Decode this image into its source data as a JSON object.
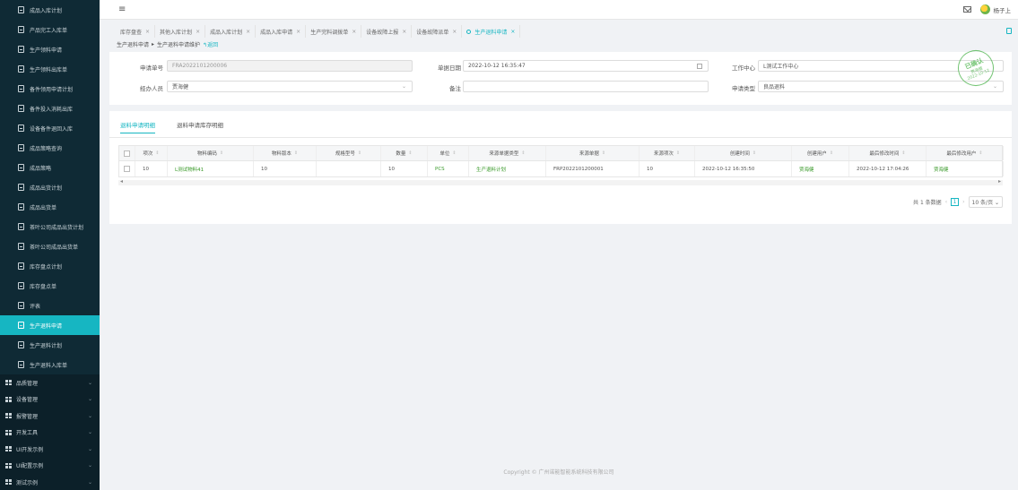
{
  "sidebar": {
    "items": [
      {
        "label": "成品入库计划"
      },
      {
        "label": "产品完工入库单"
      },
      {
        "label": "生产领料申请"
      },
      {
        "label": "生产领料出库单"
      },
      {
        "label": "备件领用申请计划"
      },
      {
        "label": "备件投入消耗出库"
      },
      {
        "label": "设备备件退回入库"
      },
      {
        "label": "成品策略查询"
      },
      {
        "label": "成品策略"
      },
      {
        "label": "成品出货计划"
      },
      {
        "label": "成品出货单"
      },
      {
        "label": "茶叶公司成品出货计划"
      },
      {
        "label": "茶叶公司成品出货单"
      },
      {
        "label": "库存盘点计划"
      },
      {
        "label": "库存盘点单"
      },
      {
        "label": "评表"
      },
      {
        "label": "生产退料申请"
      },
      {
        "label": "生产退料计划"
      },
      {
        "label": "生产退料入库单"
      }
    ],
    "active_index": 16,
    "groups": [
      {
        "label": "品质管理"
      },
      {
        "label": "设备管理"
      },
      {
        "label": "报警管理"
      },
      {
        "label": "开发工具"
      },
      {
        "label": "UI开发示例"
      },
      {
        "label": "UI配置示例"
      },
      {
        "label": "测试示例"
      }
    ]
  },
  "header": {
    "menu_icon": "≡",
    "username": "杨子上"
  },
  "tabs": [
    {
      "label": "库存盘查"
    },
    {
      "label": "其他入库计划"
    },
    {
      "label": "成品入库计划"
    },
    {
      "label": "成品入库申请"
    },
    {
      "label": "生产完料调拨单"
    },
    {
      "label": "设备故障上报"
    },
    {
      "label": "设备故障派单"
    },
    {
      "label": "生产退料申请",
      "active": true
    }
  ],
  "breadcrumb": {
    "first": "生产退料申请",
    "sep": "▸",
    "second": "生产退料申请维护",
    "back": "↰返回"
  },
  "form": {
    "apply_no_label": "申请单号",
    "apply_no_value": "FRA2022101200006",
    "date_label": "单据日期",
    "date_value": "2022-10-12 16:35:47",
    "work_center_label": "工作中心",
    "work_center_value": "L测试工作中心",
    "handler_label": "经办人员",
    "handler_value": "贾海健",
    "remark_label": "备注",
    "remark_value": "",
    "type_label": "申请类型",
    "type_value": "良品退料"
  },
  "stamp": {
    "line1": "已确认",
    "line2": "贾海健",
    "line3": "2022-10-12"
  },
  "detail": {
    "tabs": [
      "退料申请明细",
      "退料申请库存明细"
    ],
    "active_tab": 0,
    "columns": [
      "项次",
      "物料编码",
      "物料版本",
      "规格型号",
      "数量",
      "单位",
      "来源单据类型",
      "来源单据",
      "来源项次",
      "创建时间",
      "创建用户",
      "最后修改时间",
      "最后修改用户"
    ],
    "rows": [
      {
        "seq": "10",
        "code": "L测试物料41",
        "version": "10",
        "spec": "",
        "qty": "10",
        "unit": "PCS",
        "src_type": "生产退料计划",
        "src_no": "FRP2022101200001",
        "src_seq": "10",
        "created": "2022-10-12 16:35:50",
        "creator": "贾海健",
        "modified": "2022-10-12 17:04:26",
        "modifier": "贾海健"
      }
    ]
  },
  "pager": {
    "total": "共 1 条数据",
    "prev": "‹",
    "page": "1",
    "next": "›",
    "size": "10 条/页 ⌄"
  },
  "footer": {
    "text": "Copyright © 广州诺能智能系统科技有限公司"
  },
  "colors": {
    "accent": "#16b6c2",
    "sidebar_bg": "#0f2a35",
    "link_green": "#3a9a2a"
  }
}
